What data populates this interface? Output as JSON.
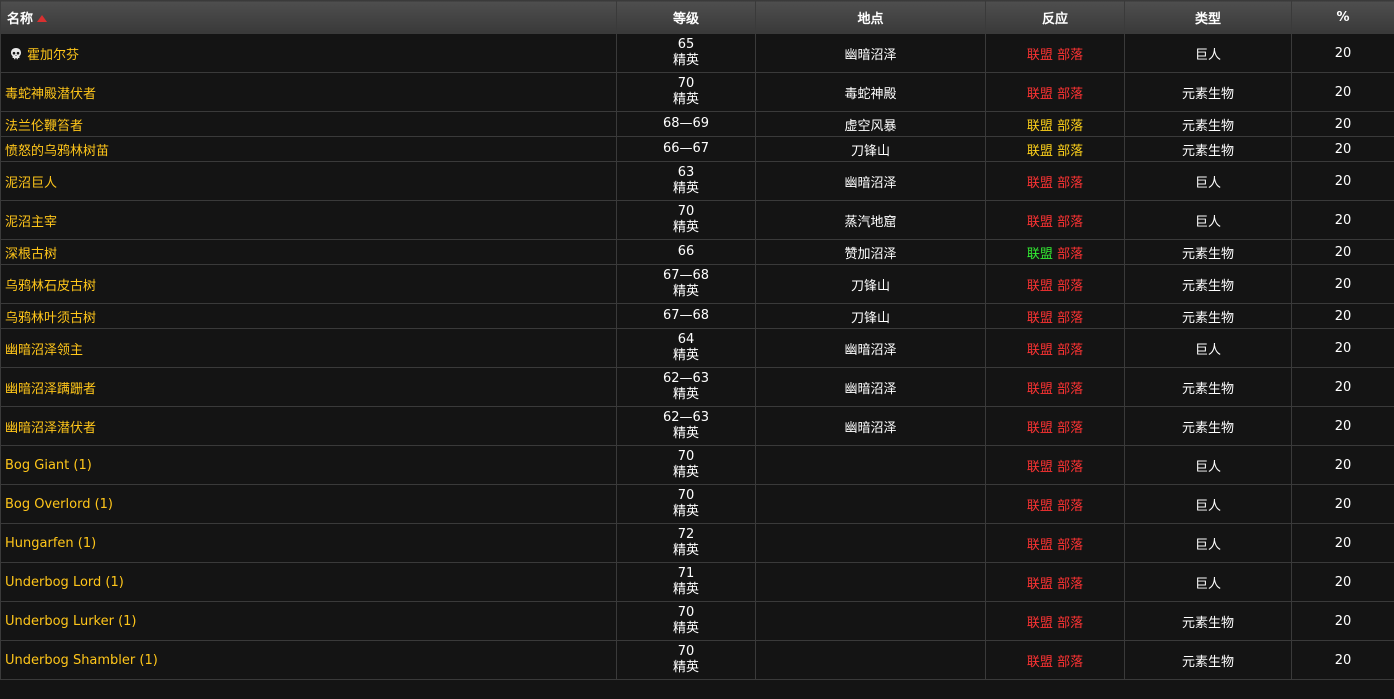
{
  "headers": {
    "name": "名称",
    "level": "等级",
    "location": "地点",
    "react": "反应",
    "type": "类型",
    "pct": "%"
  },
  "colors": {
    "name_link": "#ffc61a",
    "react_hostile": "#ff3333",
    "react_neutral": "#ffd21a",
    "react_friendly": "#33ee33"
  },
  "rows": [
    {
      "name": "霍加尔芬",
      "boss": true,
      "level": "65",
      "elite": "精英",
      "location": "幽暗沼泽",
      "alliance": "联盟",
      "alliance_color": "red",
      "horde": "部落",
      "horde_color": "red",
      "type": "巨人",
      "pct": "20"
    },
    {
      "name": "毒蛇神殿潜伏者",
      "boss": false,
      "level": "70",
      "elite": "精英",
      "location": "毒蛇神殿",
      "alliance": "联盟",
      "alliance_color": "red",
      "horde": "部落",
      "horde_color": "red",
      "type": "元素生物",
      "pct": "20"
    },
    {
      "name": "法兰伦鞭笞者",
      "boss": false,
      "level": "68—69",
      "elite": "",
      "location": "虚空风暴",
      "alliance": "联盟",
      "alliance_color": "yellow",
      "horde": "部落",
      "horde_color": "yellow",
      "type": "元素生物",
      "pct": "20"
    },
    {
      "name": "愤怒的乌鸦林树苗",
      "boss": false,
      "level": "66—67",
      "elite": "",
      "location": "刀锋山",
      "alliance": "联盟",
      "alliance_color": "yellow",
      "horde": "部落",
      "horde_color": "yellow",
      "type": "元素生物",
      "pct": "20"
    },
    {
      "name": "泥沼巨人",
      "boss": false,
      "level": "63",
      "elite": "精英",
      "location": "幽暗沼泽",
      "alliance": "联盟",
      "alliance_color": "red",
      "horde": "部落",
      "horde_color": "red",
      "type": "巨人",
      "pct": "20"
    },
    {
      "name": "泥沼主宰",
      "boss": false,
      "level": "70",
      "elite": "精英",
      "location": "蒸汽地窟",
      "alliance": "联盟",
      "alliance_color": "red",
      "horde": "部落",
      "horde_color": "red",
      "type": "巨人",
      "pct": "20"
    },
    {
      "name": "深根古树",
      "boss": false,
      "level": "66",
      "elite": "",
      "location": "赞加沼泽",
      "alliance": "联盟",
      "alliance_color": "green",
      "horde": "部落",
      "horde_color": "red",
      "type": "元素生物",
      "pct": "20"
    },
    {
      "name": "乌鸦林石皮古树",
      "boss": false,
      "level": "67—68",
      "elite": "精英",
      "location": "刀锋山",
      "alliance": "联盟",
      "alliance_color": "red",
      "horde": "部落",
      "horde_color": "red",
      "type": "元素生物",
      "pct": "20"
    },
    {
      "name": "乌鸦林叶须古树",
      "boss": false,
      "level": "67—68",
      "elite": "",
      "location": "刀锋山",
      "alliance": "联盟",
      "alliance_color": "red",
      "horde": "部落",
      "horde_color": "red",
      "type": "元素生物",
      "pct": "20"
    },
    {
      "name": "幽暗沼泽领主",
      "boss": false,
      "level": "64",
      "elite": "精英",
      "location": "幽暗沼泽",
      "alliance": "联盟",
      "alliance_color": "red",
      "horde": "部落",
      "horde_color": "red",
      "type": "巨人",
      "pct": "20"
    },
    {
      "name": "幽暗沼泽蹒跚者",
      "boss": false,
      "level": "62—63",
      "elite": "精英",
      "location": "幽暗沼泽",
      "alliance": "联盟",
      "alliance_color": "red",
      "horde": "部落",
      "horde_color": "red",
      "type": "元素生物",
      "pct": "20"
    },
    {
      "name": "幽暗沼泽潜伏者",
      "boss": false,
      "level": "62—63",
      "elite": "精英",
      "location": "幽暗沼泽",
      "alliance": "联盟",
      "alliance_color": "red",
      "horde": "部落",
      "horde_color": "red",
      "type": "元素生物",
      "pct": "20"
    },
    {
      "name": "Bog Giant (1)",
      "boss": false,
      "level": "70",
      "elite": "精英",
      "location": "",
      "alliance": "联盟",
      "alliance_color": "red",
      "horde": "部落",
      "horde_color": "red",
      "type": "巨人",
      "pct": "20"
    },
    {
      "name": "Bog Overlord (1)",
      "boss": false,
      "level": "70",
      "elite": "精英",
      "location": "",
      "alliance": "联盟",
      "alliance_color": "red",
      "horde": "部落",
      "horde_color": "red",
      "type": "巨人",
      "pct": "20"
    },
    {
      "name": "Hungarfen (1)",
      "boss": false,
      "level": "72",
      "elite": "精英",
      "location": "",
      "alliance": "联盟",
      "alliance_color": "red",
      "horde": "部落",
      "horde_color": "red",
      "type": "巨人",
      "pct": "20"
    },
    {
      "name": "Underbog Lord (1)",
      "boss": false,
      "level": "71",
      "elite": "精英",
      "location": "",
      "alliance": "联盟",
      "alliance_color": "red",
      "horde": "部落",
      "horde_color": "red",
      "type": "巨人",
      "pct": "20"
    },
    {
      "name": "Underbog Lurker (1)",
      "boss": false,
      "level": "70",
      "elite": "精英",
      "location": "",
      "alliance": "联盟",
      "alliance_color": "red",
      "horde": "部落",
      "horde_color": "red",
      "type": "元素生物",
      "pct": "20"
    },
    {
      "name": "Underbog Shambler (1)",
      "boss": false,
      "level": "70",
      "elite": "精英",
      "location": "",
      "alliance": "联盟",
      "alliance_color": "red",
      "horde": "部落",
      "horde_color": "red",
      "type": "元素生物",
      "pct": "20"
    }
  ]
}
